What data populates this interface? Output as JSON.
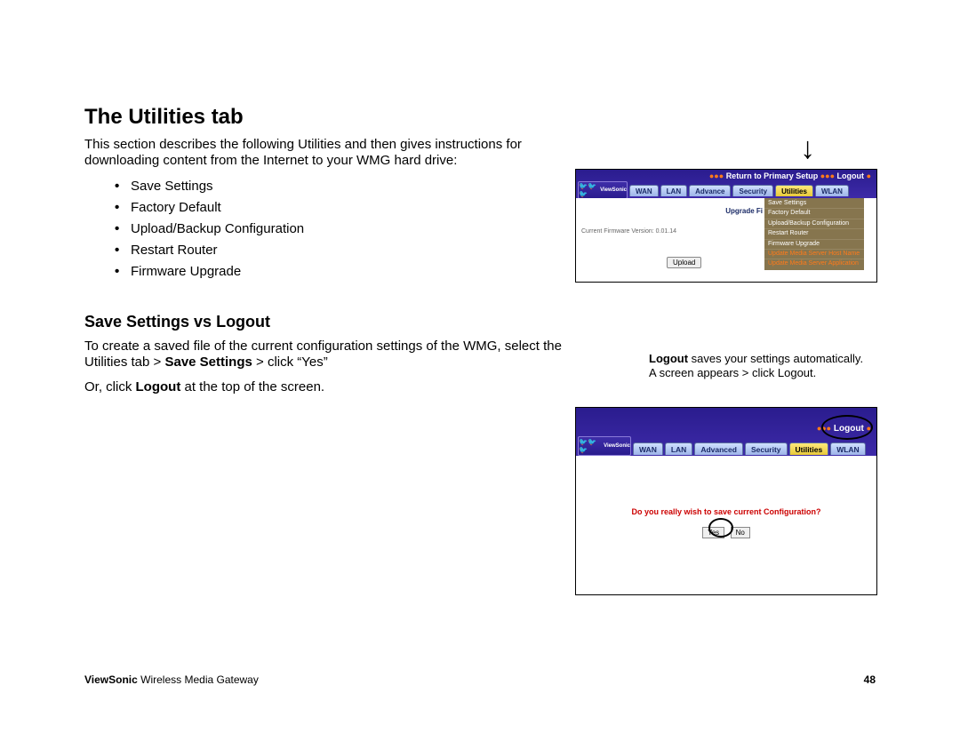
{
  "title": "The Utilities tab",
  "intro": "This section describes the following Utilities and then gives instructions for downloading content from the Internet to your WMG hard drive:",
  "bullets": [
    "Save Settings",
    "Factory Default",
    "Upload/Backup Configuration",
    "Restart Router",
    "Firmware Upgrade"
  ],
  "subtitle": "Save Settings vs Logout",
  "para1_pre": "To create a saved file of the current configuration settings of the WMG, select the Utilities tab > ",
  "para1_bold": "Save Settings",
  "para1_post": " > click “Yes”",
  "para2_pre": "Or, click ",
  "para2_bold": "Logout",
  "para2_post": " at the top of the screen.",
  "callout_bold": "Logout",
  "callout_rest": " saves your settings automatically. A screen appears > click Logout.",
  "footer_brand": "ViewSonic",
  "footer_rest": " Wireless Media Gateway",
  "page_num": "48",
  "router": {
    "toplinks_return": "Return to Primary Setup",
    "toplinks_logout": "Logout",
    "tabs": [
      "WAN",
      "LAN",
      "Advance",
      "Security",
      "Utilities",
      "WLAN"
    ],
    "tabs2": [
      "WAN",
      "LAN",
      "Advanced",
      "Security",
      "Utilities",
      "WLAN"
    ],
    "brand": "ViewSonic",
    "upgrade_label": "Upgrade Fi",
    "fw_label": "Current Firmware Version:   0.01.14",
    "upload_btn": "Upload",
    "util_menu": [
      {
        "t": "Save Settings",
        "o": false
      },
      {
        "t": "Factory Default",
        "o": false
      },
      {
        "t": "Upload/Backup Configuration",
        "o": false
      },
      {
        "t": "Restart Router",
        "o": false
      },
      {
        "t": "Firmware Upgrade",
        "o": false
      },
      {
        "t": "Update Media Server Host Name",
        "o": true
      },
      {
        "t": "Update Media Server Application",
        "o": true
      }
    ],
    "confirm_msg": "Do you really wish to save current Configuration?",
    "yes": "Yes",
    "no": "No"
  }
}
